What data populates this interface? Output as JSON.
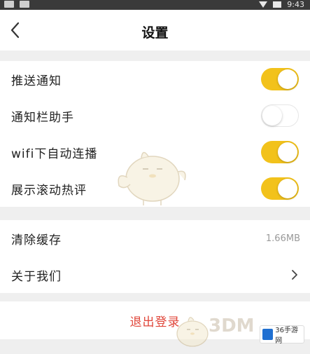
{
  "statusbar": {
    "time": "9:43"
  },
  "header": {
    "title": "设置",
    "back_icon": "chevron-left-icon"
  },
  "toggles": [
    {
      "label": "推送通知",
      "on": true
    },
    {
      "label": "通知栏助手",
      "on": false
    },
    {
      "label": "wifi下自动连播",
      "on": true
    },
    {
      "label": "展示滚动热评",
      "on": true
    }
  ],
  "cache": {
    "label": "清除缓存",
    "value": "1.66MB"
  },
  "about": {
    "label": "关于我们",
    "chevron_icon": "chevron-right-icon"
  },
  "logout": {
    "label": "退出登录"
  },
  "watermark": {
    "text": "3DM",
    "badge": "36手游网"
  },
  "colors": {
    "accent": "#f2c21b",
    "logout": "#e0463a",
    "background": "#efefef"
  }
}
